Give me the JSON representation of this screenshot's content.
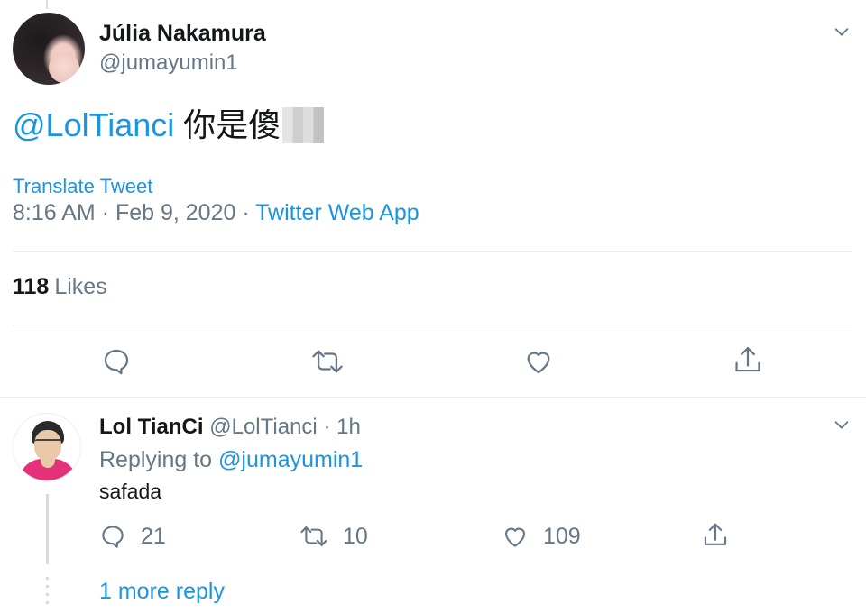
{
  "main_tweet": {
    "author_name": "Júlia Nakamura",
    "author_handle": "@jumayumin1",
    "text_mention": "@LolTianci",
    "text_body": "你是傻",
    "translate_label": "Translate Tweet",
    "timestamp": "8:16 AM · Feb 9, 2020 · ",
    "source": "Twitter Web App",
    "likes_count": "118",
    "likes_label": "Likes",
    "icons": {
      "reply": "comment-icon",
      "retweet": "retweet-icon",
      "like": "heart-icon",
      "share": "share-icon",
      "menu": "chevron-down-icon"
    }
  },
  "reply_tweet": {
    "author_name": "Lol TianCi",
    "author_handle": "@LolTianci",
    "separator": "·",
    "time": "1h",
    "replying_prefix": "Replying to ",
    "replying_to": "@jumayumin1",
    "text": "safada",
    "reply_count": "21",
    "retweet_count": "10",
    "like_count": "109",
    "more_replies": "1 more reply"
  },
  "colors": {
    "link": "#1b95e0",
    "secondary_text": "#657786",
    "primary_text": "#14171a",
    "divider": "#e6ecf0"
  }
}
